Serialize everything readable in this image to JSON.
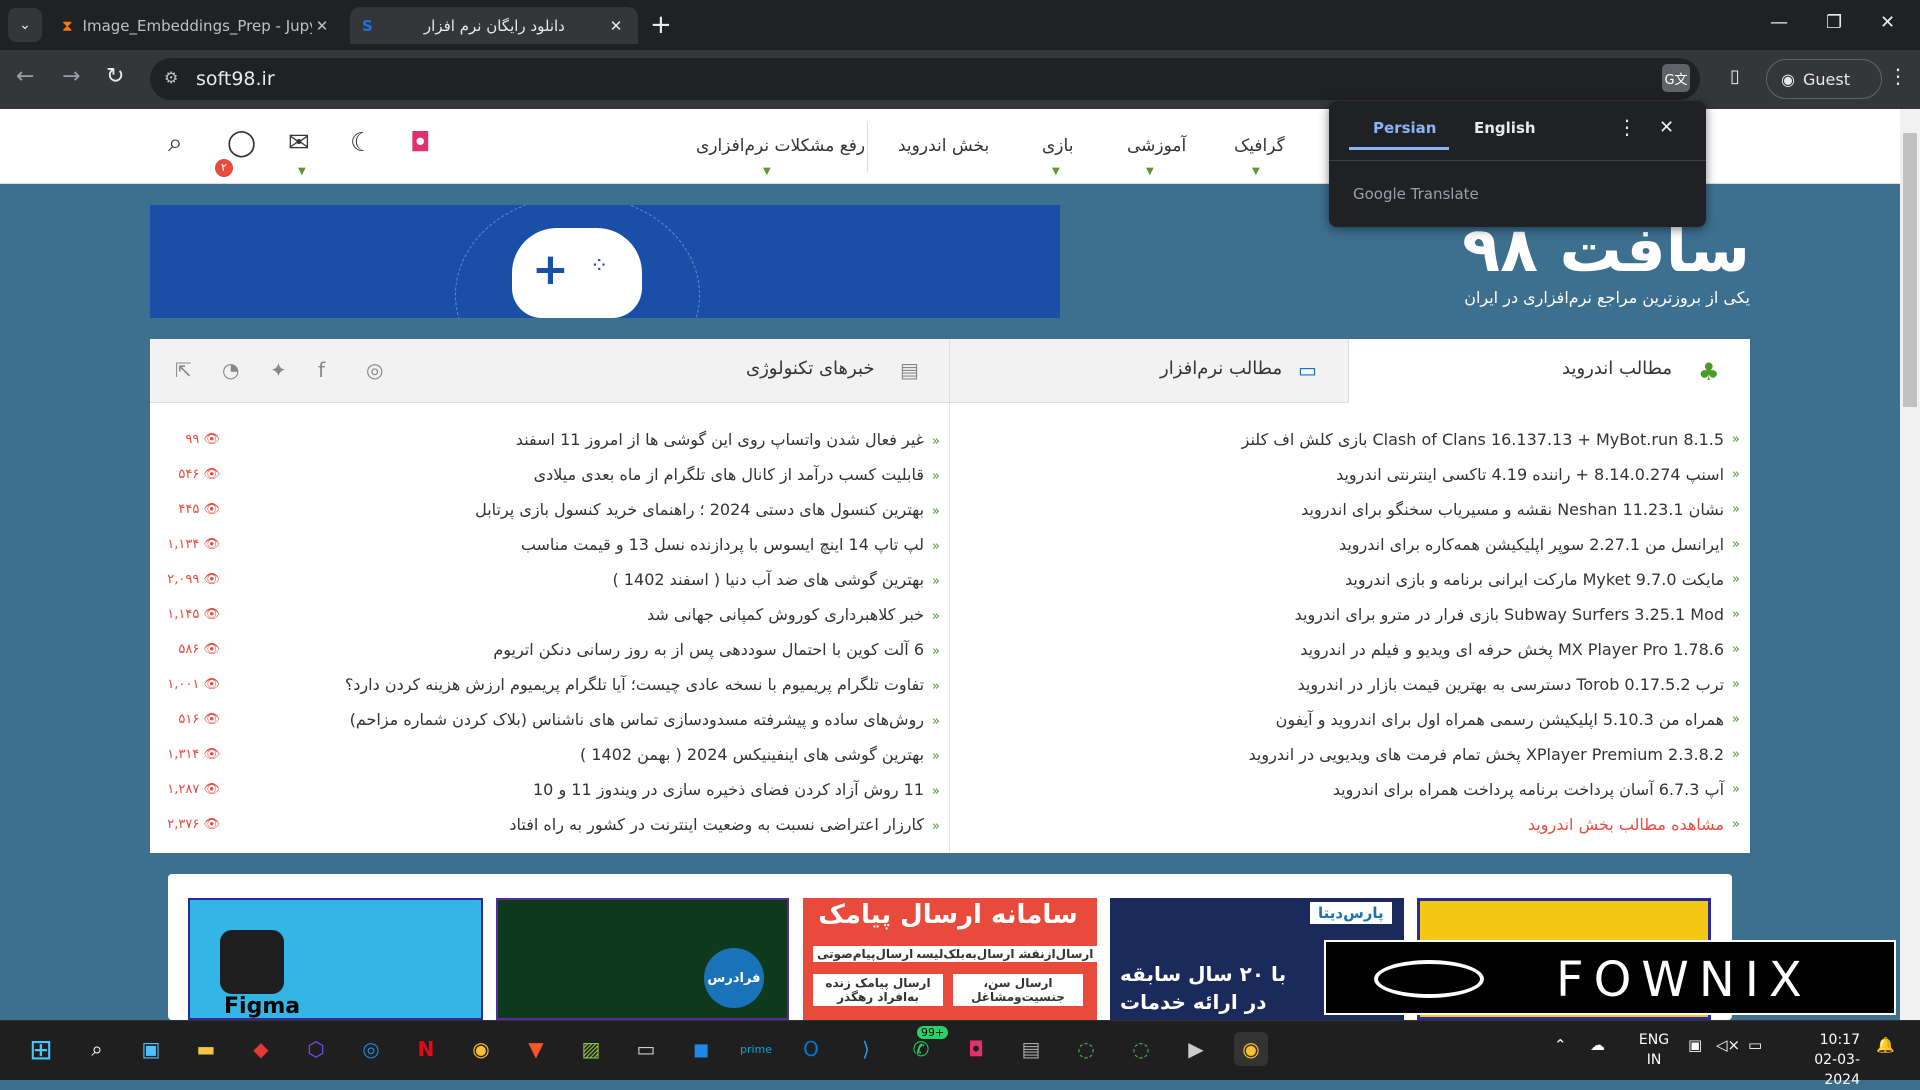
{
  "browser": {
    "tabs": [
      {
        "title": "Image_Embeddings_Prep - Jupy",
        "icon": "hourglass-icon"
      },
      {
        "title": "دانلود رایگان نرم افزار",
        "icon": "soft98-icon"
      }
    ],
    "url": "soft98.ir",
    "guest_label": "Guest"
  },
  "translate_popup": {
    "tabs": [
      "Persian",
      "English"
    ],
    "brand": "Google Translate"
  },
  "site": {
    "nav": [
      "گرافیک",
      "آموزشی",
      "بازی",
      "بخش اندروید",
      "رفع مشکلات نرم‌افزاری"
    ],
    "notification_count": "۲",
    "logo_text": "سافت ۹۸",
    "tagline": "یکی از بروزترین مراجع نرم‌افزاری در ایران"
  },
  "sections": {
    "android_title": "مطالب اندروید",
    "software_title": "مطالب نرم‌افزار",
    "news_title": "خبرهای تکنولوژی"
  },
  "android_list": [
    "Clash of Clans 16.137.13 + MyBot.run 8.1.5 بازی کلش اف کلنز",
    "اسنپ 8.14.0.274 + راننده 4.19 تاکسی اینترنتی اندروید",
    "نشان Neshan 11.23.1 نقشه و مسیریاب سخنگو برای اندروید",
    "ایرانسل من 2.27.1 سوپر اپلیکیشن همه‌کاره برای اندروید",
    "مایکت Myket 9.7.0 مارکت ایرانی برنامه و بازی اندروید",
    "Subway Surfers 3.25.1 Mod بازی فرار در مترو برای اندروید",
    "MX Player Pro 1.78.6 پخش حرفه ای ویدیو و فیلم در اندروید",
    "ترب Torob 0.17.5.2 دسترسی به بهترین قیمت بازار در اندروید",
    "همراه من 5.10.3 اپلیکیشن رسمی همراه اول برای اندروید و آیفون",
    "XPlayer Premium 2.3.8.2 پخش تمام فرمت های ویدیویی در اندروید",
    "آپ 6.7.3 آسان پرداخت برنامه پرداخت همراه برای اندروید"
  ],
  "android_more": "مشاهده مطالب بخش اندروید",
  "news_list": [
    {
      "title": "غیر فعال شدن واتساپ روی این گوشی ها از امروز 11 اسفند",
      "views": "۹۹"
    },
    {
      "title": "قابلیت کسب درآمد از کانال های تلگرام از ماه بعدی میلادی",
      "views": "۵۴۶"
    },
    {
      "title": "بهترین کنسول های دستی 2024 ؛ راهنمای خرید کنسول بازی پرتابل",
      "views": "۴۴۵"
    },
    {
      "title": "لپ تاپ 14 اینچ ایسوس با پردازنده نسل 13 و قیمت مناسب",
      "views": "۱,۱۳۴"
    },
    {
      "title": "بهترین گوشی های ضد آب دنیا ( اسفند 1402 )",
      "views": "۲,۰۹۹"
    },
    {
      "title": "خبر کلاهبرداری کوروش کمپانی جهانی شد",
      "views": "۱,۱۴۵"
    },
    {
      "title": "6 آلت کوین با احتمال سوددهی پس از به روز رسانی دنکن اتریوم",
      "views": "۵۸۶"
    },
    {
      "title": "تفاوت تلگرام پریمیوم با نسخه عادی چیست؛ آیا تلگرام پریمیوم ارزش هزینه کردن دارد؟",
      "views": "۱,۰۰۱"
    },
    {
      "title": "روش‌های ساده و پیشرفته مسدودسازی تماس های ناشناس (بلاک کردن شماره مزاحم)",
      "views": "۵۱۶"
    },
    {
      "title": "بهترین گوشی های اینفینیکس 2024 ( بهمن 1402 )",
      "views": "۱,۳۱۴"
    },
    {
      "title": "11 روش آزاد کردن فضای ذخیره سازی در ویندوز 11 و 10",
      "views": "۱,۲۸۷"
    },
    {
      "title": "کارزار اعتراضی نسبت به وضعیت اینترنت در کشور به راه افتاد",
      "views": "۲,۳۷۶"
    }
  ],
  "ads": {
    "figma": "Figma",
    "faradars": "فرادرس",
    "sms_title": "سامانه ارسال پیامک",
    "sms_items": [
      "ارسال‌ازنقشه",
      "ارسال‌به‌بلک‌لیست",
      "ارسال‌پیام‌صوتی",
      "ارسال سن، جنسیت‌ومشاغل",
      "ارسال پیامک زنده به‌افراد رهگذر"
    ],
    "parsdata_brand": "پارس‌دیتا",
    "parsdata_line1": "با ۲۰ سال سابقه",
    "parsdata_line2": "در ارائه خدمات"
  },
  "watermark": "FOWNIX",
  "taskbar": {
    "lang_line1": "ENG",
    "lang_line2": "IN",
    "time": "10:17",
    "date": "02-03-2024",
    "whatsapp_badge": "99+"
  }
}
